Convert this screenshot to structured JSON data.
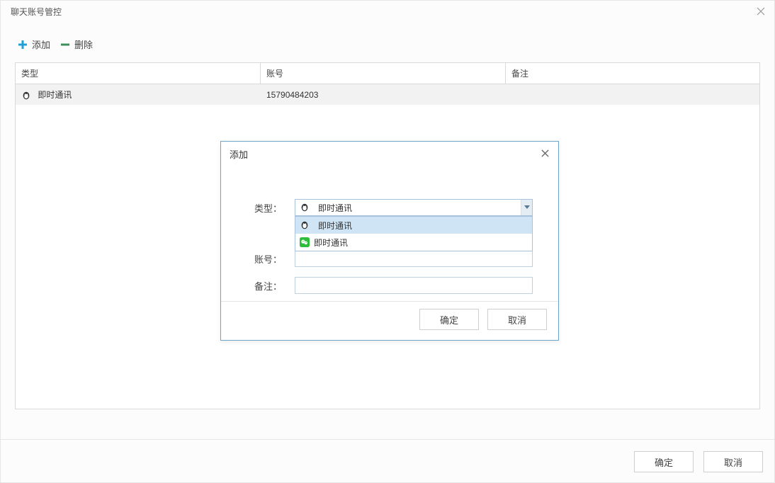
{
  "title": "聊天账号管控",
  "toolbar": {
    "add_label": "添加",
    "delete_label": "删除"
  },
  "table": {
    "headers": {
      "type": "类型",
      "account": "账号",
      "note": "备注"
    },
    "rows": [
      {
        "type": "即时通讯",
        "account": "15790484203",
        "note": ""
      }
    ]
  },
  "add_dialog": {
    "title": "添加",
    "labels": {
      "type": "类型：",
      "account": "账号：",
      "note": "备注："
    },
    "selected_type": "即时通讯",
    "options": [
      {
        "icon": "qq",
        "label": "即时通讯"
      },
      {
        "icon": "wechat",
        "label": "即时通讯"
      }
    ],
    "buttons": {
      "ok": "确定",
      "cancel": "取消"
    },
    "account_value": "",
    "note_value": ""
  },
  "footer": {
    "ok": "确定",
    "cancel": "取消"
  }
}
